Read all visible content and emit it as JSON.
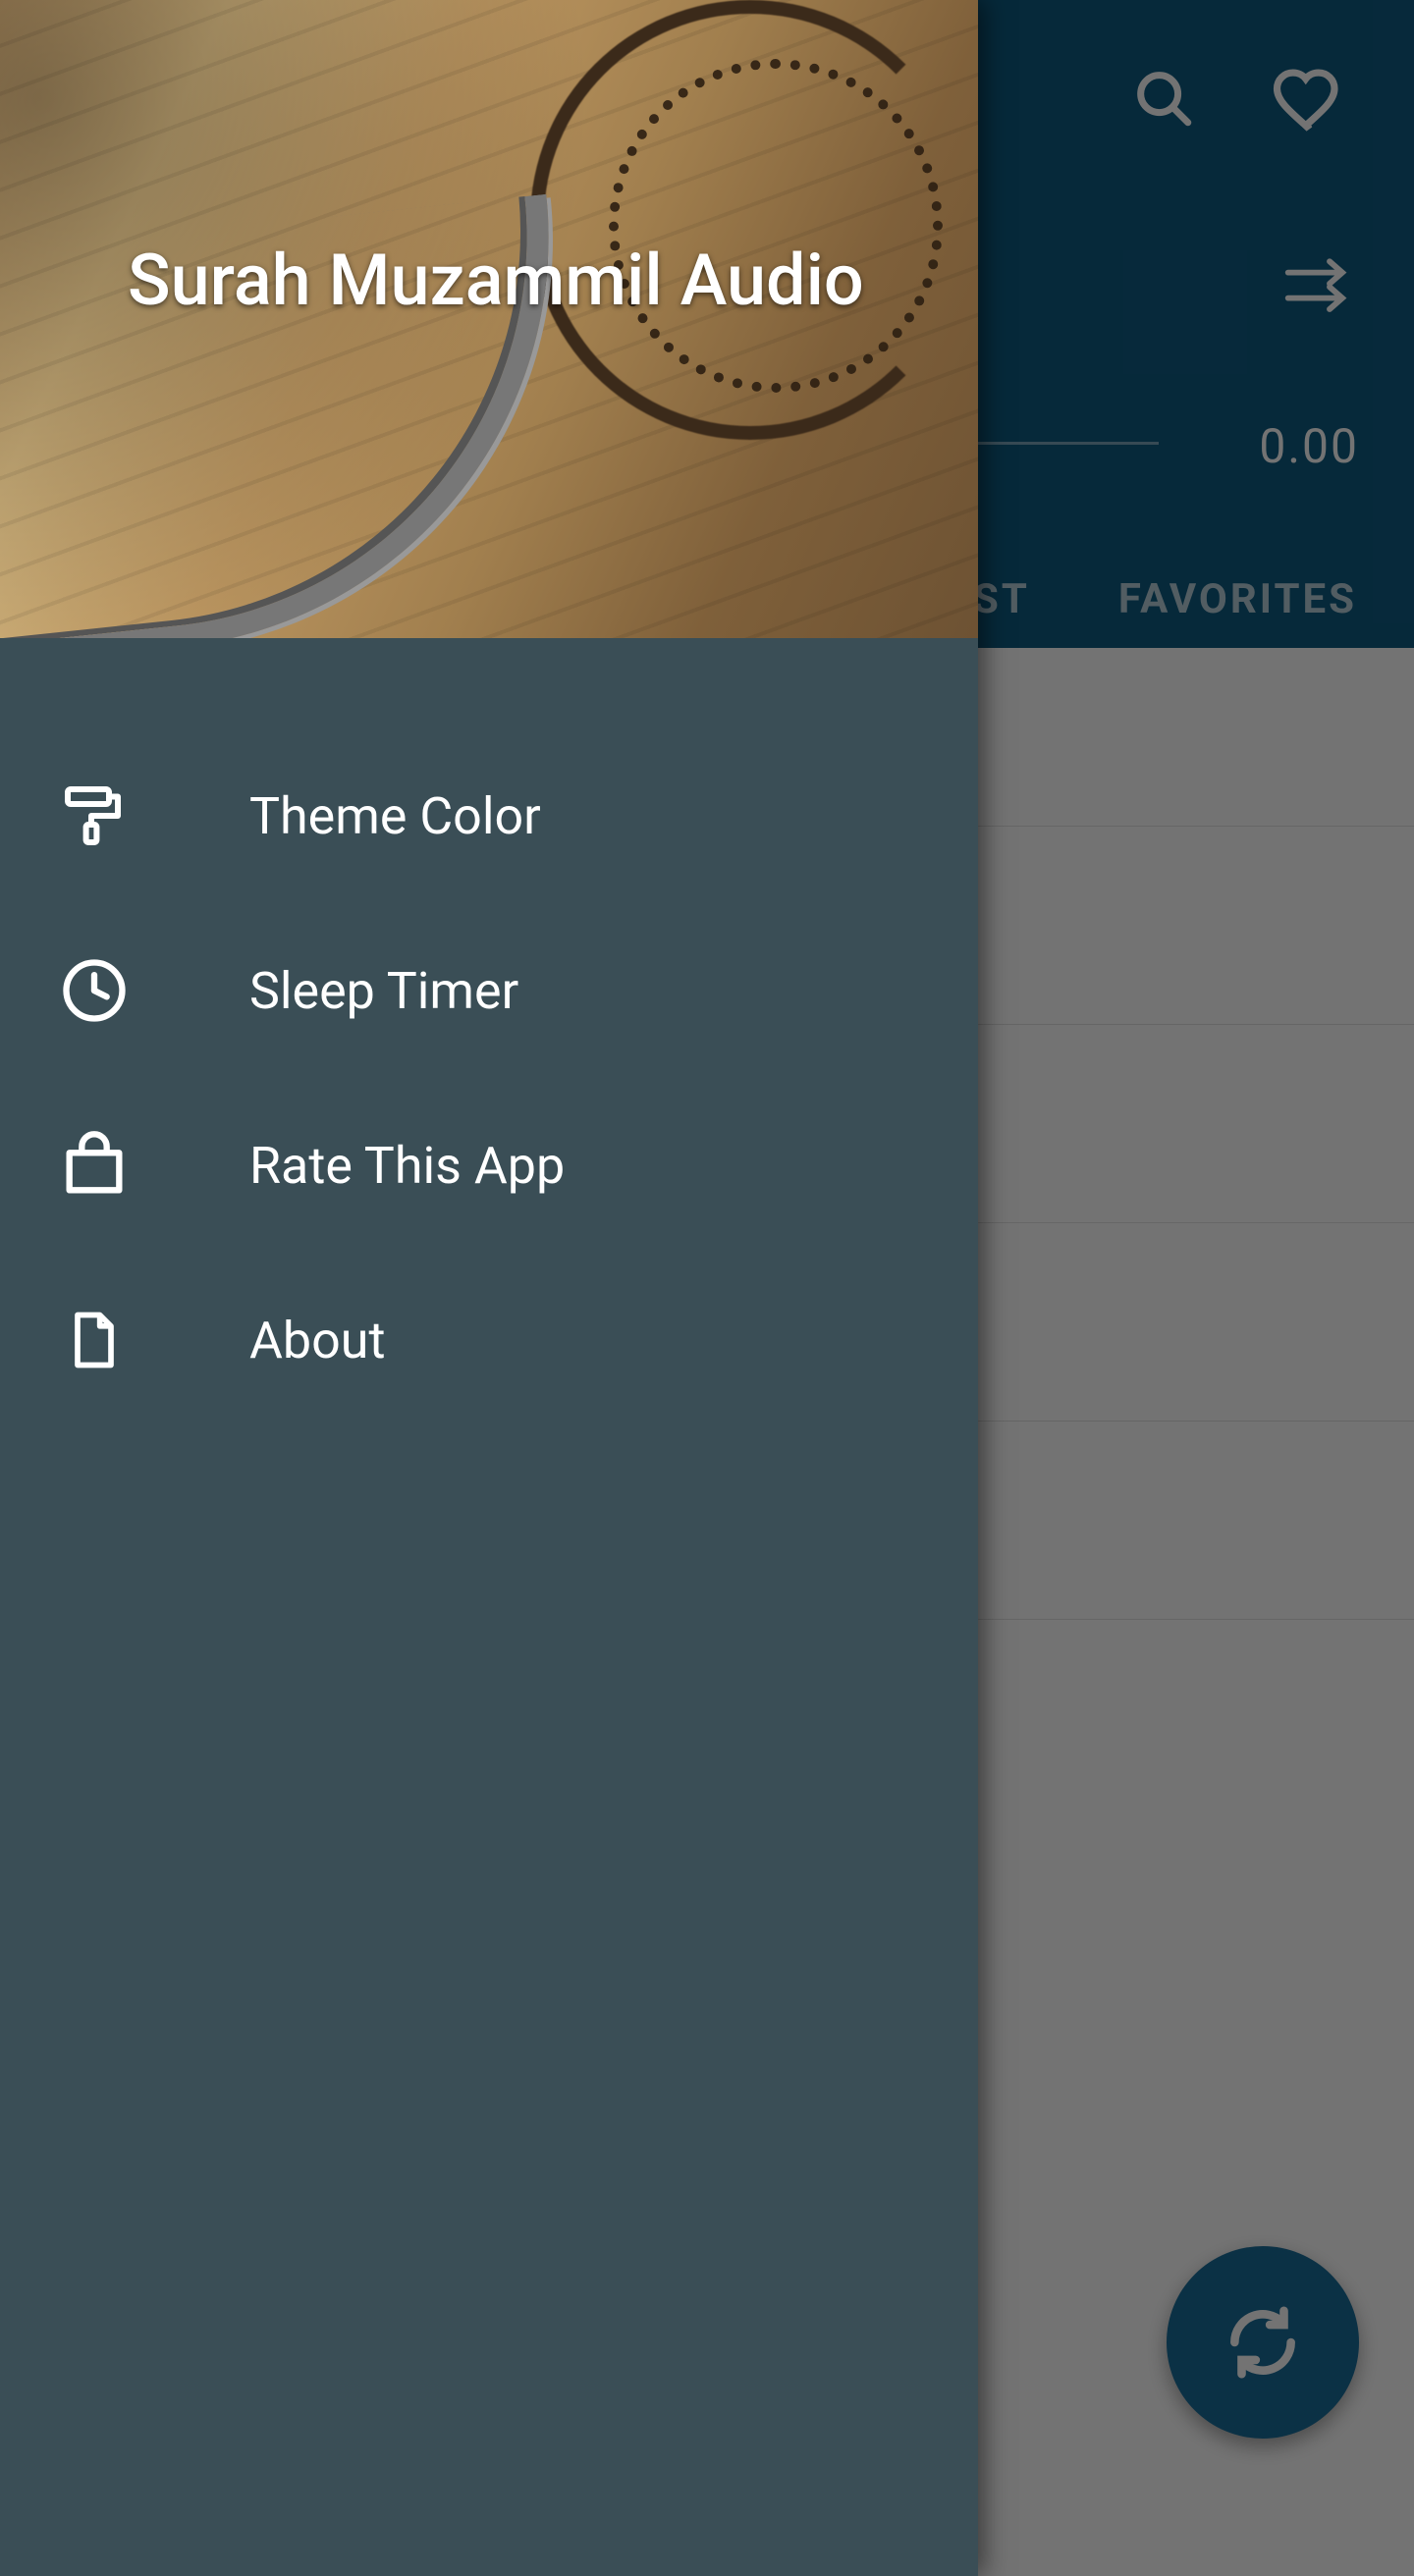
{
  "app_title": "Surah Muzammil Audio",
  "header": {
    "time_display": "0.00"
  },
  "tabs": {
    "playlist": "ST",
    "favorites": "FAVORITES"
  },
  "drawer": {
    "title": "Surah Muzammil Audio",
    "items": [
      {
        "icon": "roller-brush-icon",
        "label": "Theme Color"
      },
      {
        "icon": "clock-icon",
        "label": "Sleep Timer"
      },
      {
        "icon": "bag-icon",
        "label": "Rate This App"
      },
      {
        "icon": "file-icon",
        "label": "About"
      }
    ]
  },
  "colors": {
    "primary": "#0f5c82",
    "drawer_bg": "#3a4e56",
    "fab": "#1a6d99"
  }
}
